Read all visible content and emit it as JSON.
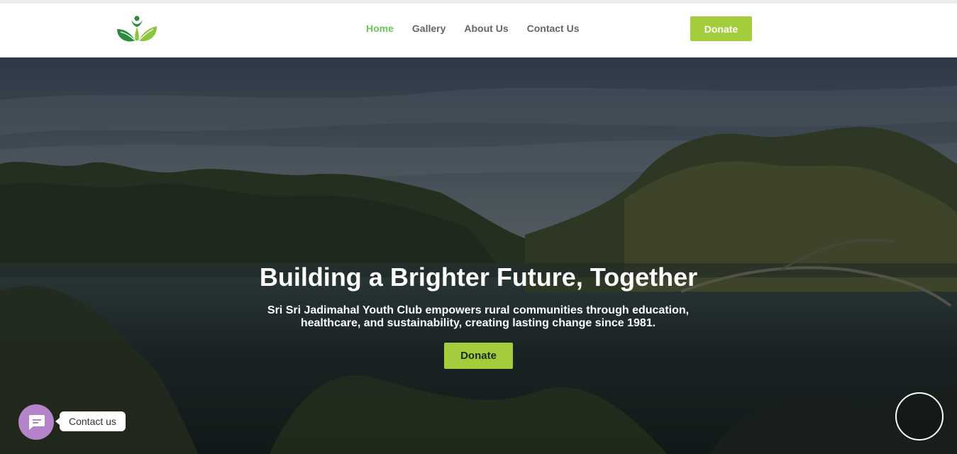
{
  "nav": {
    "logo_icon": "leaf-person-logo",
    "links": [
      "Home",
      "Gallery",
      "About Us",
      "Contact Us"
    ],
    "active_link": "Home",
    "donate_label": "Donate"
  },
  "hero": {
    "title": "Building a Brighter Future, Together",
    "subtitle": "Sri Sri Jadimahal Youth Club empowers rural communities through education, healthcare, and sustainability, creating lasting change since 1981.",
    "donate_label": "Donate"
  },
  "chat": {
    "label": "Contact us",
    "icon": "chat-icon"
  },
  "colors": {
    "accent_green": "#a3cd3c",
    "nav_active": "#72c45a",
    "nav_text": "#666666",
    "chat_purple": "#b583c9"
  }
}
